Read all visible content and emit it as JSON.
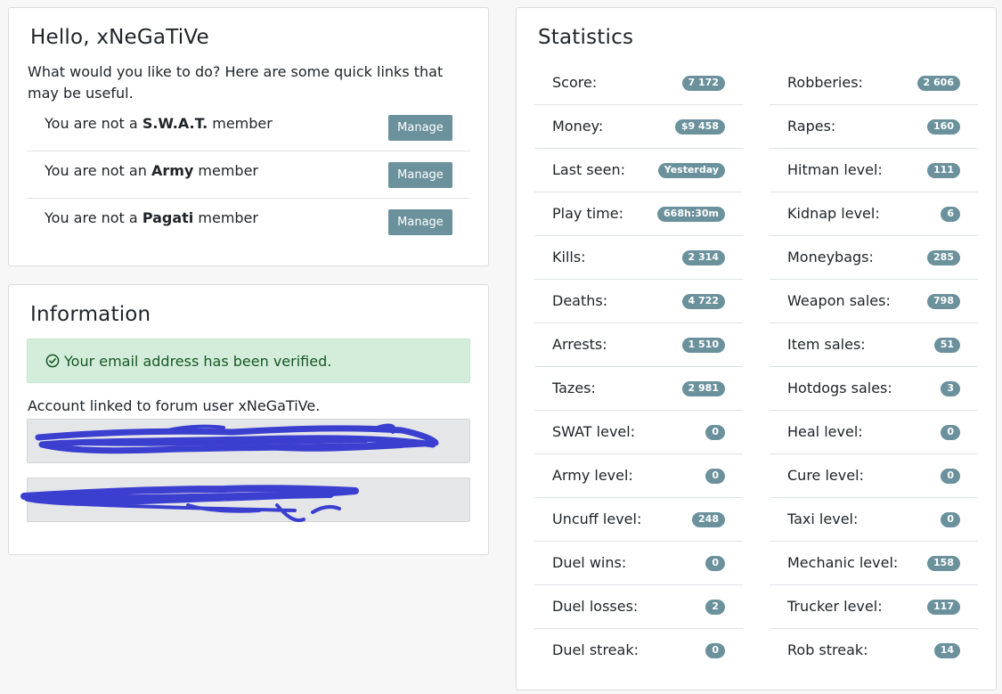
{
  "hello": {
    "title": "Hello, xNeGaTiVe",
    "intro": "What would you like to do? Here are some quick links that may be useful.",
    "memberships": [
      {
        "prefix": "You are not a ",
        "group": "S.W.A.T.",
        "suffix": " member",
        "button": "Manage"
      },
      {
        "prefix": "You are not an ",
        "group": "Army",
        "suffix": " member",
        "button": "Manage"
      },
      {
        "prefix": "You are not a ",
        "group": "Pagati",
        "suffix": " member",
        "button": "Manage"
      }
    ]
  },
  "information": {
    "title": "Information",
    "email_alert": "Your email address has been verified.",
    "linked_account": "Account linked to forum user xNeGaTiVe.",
    "redaction_color": "#3b3fd0"
  },
  "statistics": {
    "title": "Statistics",
    "left": [
      {
        "label": "Score:",
        "value": "7 172"
      },
      {
        "label": "Money:",
        "value": "$9 458"
      },
      {
        "label": "Last seen:",
        "value": "Yesterday"
      },
      {
        "label": "Play time:",
        "value": "668h:30m"
      },
      {
        "label": "Kills:",
        "value": "2 314"
      },
      {
        "label": "Deaths:",
        "value": "4 722"
      },
      {
        "label": "Arrests:",
        "value": "1 510"
      },
      {
        "label": "Tazes:",
        "value": "2 981"
      },
      {
        "label": "SWAT level:",
        "value": "0"
      },
      {
        "label": "Army level:",
        "value": "0"
      },
      {
        "label": "Uncuff level:",
        "value": "248"
      },
      {
        "label": "Duel wins:",
        "value": "0"
      },
      {
        "label": "Duel losses:",
        "value": "2"
      },
      {
        "label": "Duel streak:",
        "value": "0"
      }
    ],
    "right": [
      {
        "label": "Robberies:",
        "value": "2 606"
      },
      {
        "label": "Rapes:",
        "value": "160"
      },
      {
        "label": "Hitman level:",
        "value": "111"
      },
      {
        "label": "Kidnap level:",
        "value": "6"
      },
      {
        "label": "Moneybags:",
        "value": "285"
      },
      {
        "label": "Weapon sales:",
        "value": "798"
      },
      {
        "label": "Item sales:",
        "value": "51"
      },
      {
        "label": "Hotdogs sales:",
        "value": "3"
      },
      {
        "label": "Heal level:",
        "value": "0"
      },
      {
        "label": "Cure level:",
        "value": "0"
      },
      {
        "label": "Taxi level:",
        "value": "0"
      },
      {
        "label": "Mechanic level:",
        "value": "158"
      },
      {
        "label": "Trucker level:",
        "value": "117"
      },
      {
        "label": "Rob streak:",
        "value": "14"
      }
    ]
  },
  "colors": {
    "badge": "#6a919c",
    "button": "#6a919c",
    "alert_bg": "#d4edda",
    "alert_text": "#155724"
  },
  "icons": {
    "alert": "check-circle-icon"
  }
}
